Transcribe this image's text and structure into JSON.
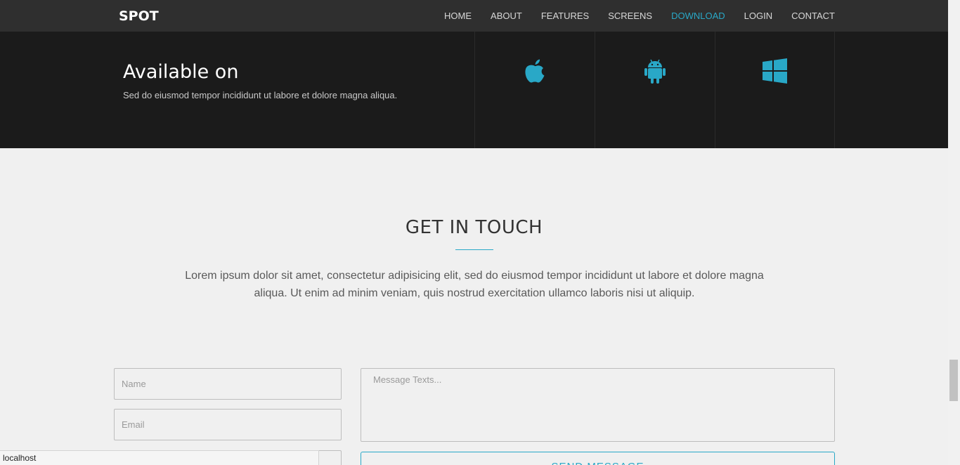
{
  "navbar": {
    "logo": "SPOT",
    "items": [
      {
        "label": "HOME"
      },
      {
        "label": "ABOUT"
      },
      {
        "label": "FEATURES"
      },
      {
        "label": "SCREENS"
      },
      {
        "label": "DOWNLOAD",
        "active": true
      },
      {
        "label": "LOGIN"
      },
      {
        "label": "CONTACT"
      }
    ]
  },
  "available": {
    "title": "Available on",
    "subtitle": "Sed do eiusmod tempor incididunt ut labore et dolore magna aliqua.",
    "platforms": [
      {
        "icon": "apple-icon"
      },
      {
        "icon": "android-icon"
      },
      {
        "icon": "windows-icon"
      }
    ]
  },
  "contact": {
    "title": "GET IN TOUCH",
    "text": "Lorem ipsum dolor sit amet, consectetur adipisicing elit, sed do eiusmod tempor incididunt ut labore et dolore magna aliqua. Ut enim ad minim veniam, quis nostrud exercitation ullamco laboris nisi ut aliquip.",
    "name_placeholder": "Name",
    "email_placeholder": "Email",
    "message_placeholder": "Message Texts...",
    "send_label": "SEND MESSAGE"
  },
  "statusbar": {
    "text": "localhost"
  },
  "colors": {
    "accent": "#29a8c7",
    "navbar_bg": "#2f2f2f",
    "section_dark_bg": "#1b1b1b",
    "page_bg": "#f0f0f0"
  }
}
